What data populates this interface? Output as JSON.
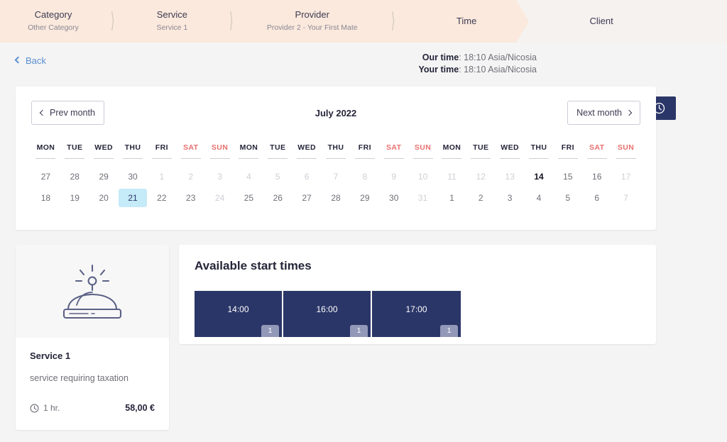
{
  "steps": {
    "items": [
      {
        "title": "Category",
        "subtitle": "Other Category"
      },
      {
        "title": "Service",
        "subtitle": "Service 1"
      },
      {
        "title": "Provider",
        "subtitle": "Provider 2 - Your First Mate"
      },
      {
        "title": "Time",
        "subtitle": ""
      },
      {
        "title": "Client",
        "subtitle": ""
      }
    ]
  },
  "subheader": {
    "back_label": "Back",
    "our_time_label": "Our time",
    "our_time_value": ": 18:10 Asia/Nicosia",
    "your_time_label": "Your time",
    "your_time_value": ": 18:10 Asia/Nicosia",
    "timezone_button": "Change my timezone"
  },
  "calendar": {
    "prev_label": "Prev month",
    "next_label": "Next month",
    "month_title": "July 2022",
    "weekdays": [
      "MON",
      "TUE",
      "WED",
      "THU",
      "FRI",
      "SAT",
      "SUN",
      "MON",
      "TUE",
      "WED",
      "THU",
      "FRI",
      "SAT",
      "SUN",
      "MON",
      "TUE",
      "WED",
      "THU",
      "FRI",
      "SAT",
      "SUN"
    ],
    "weekend_index": [
      5,
      6,
      12,
      13,
      19,
      20
    ],
    "row1": [
      "27",
      "28",
      "29",
      "30",
      "1",
      "2",
      "3",
      "4",
      "5",
      "6",
      "7",
      "8",
      "9",
      "10",
      "11",
      "12",
      "13",
      "14",
      "15",
      "16",
      "17"
    ],
    "row1_state": [
      "past",
      "past",
      "past",
      "past",
      "dim",
      "dim",
      "dim",
      "dim",
      "dim",
      "dim",
      "dim",
      "dim",
      "dim",
      "dim",
      "dim",
      "dim",
      "dim",
      "today",
      "past",
      "past",
      "dim"
    ],
    "row2": [
      "18",
      "19",
      "20",
      "21",
      "22",
      "23",
      "24",
      "25",
      "26",
      "27",
      "28",
      "29",
      "30",
      "31",
      "1",
      "2",
      "3",
      "4",
      "5",
      "6",
      "7"
    ],
    "row2_state": [
      "past",
      "past",
      "past",
      "selected",
      "past",
      "past",
      "dim",
      "past",
      "past",
      "past",
      "past",
      "past",
      "past",
      "dim",
      "past",
      "past",
      "past",
      "past",
      "past",
      "past",
      "dim"
    ]
  },
  "service": {
    "icon": "service-bell-icon",
    "name": "Service 1",
    "description": "service requiring taxation",
    "duration": "1 hr.",
    "price": "58,00 €"
  },
  "slots": {
    "title": "Available start times",
    "items": [
      {
        "time": "14:00",
        "count": "1"
      },
      {
        "time": "16:00",
        "count": "1"
      },
      {
        "time": "17:00",
        "count": "1"
      }
    ]
  },
  "colors": {
    "brand_navy": "#2b3668",
    "peach": "#fae9dc",
    "weekend_red": "#e8706e",
    "selected_day": "#c5eaf8",
    "link_blue": "#5b8fd1"
  }
}
